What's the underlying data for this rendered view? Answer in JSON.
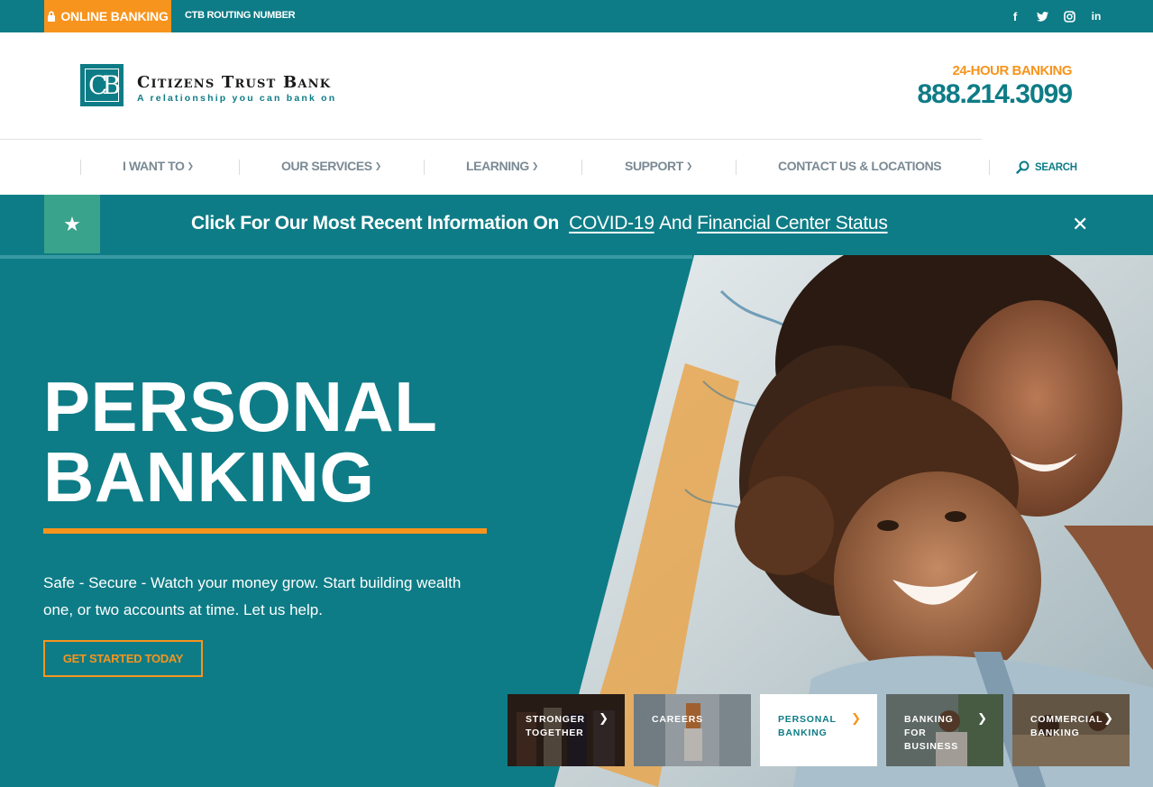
{
  "topbar": {
    "online_banking": "ONLINE BANKING",
    "routing": "CTB ROUTING NUMBER",
    "social": [
      "facebook-icon",
      "twitter-icon",
      "instagram-icon",
      "linkedin-icon"
    ]
  },
  "header": {
    "logo_name": "Citizens Trust Bank",
    "logo_tagline": "A relationship you can bank on",
    "hours_label": "24-HOUR BANKING",
    "phone": "888.214.3099"
  },
  "nav": {
    "items": [
      {
        "label": "I WANT TO"
      },
      {
        "label": "OUR SERVICES"
      },
      {
        "label": "LEARNING"
      },
      {
        "label": "SUPPORT"
      },
      {
        "label": "CONTACT US & LOCATIONS"
      }
    ],
    "search": "SEARCH"
  },
  "alert": {
    "lead": "Click For Our Most Recent Information On",
    "link1": "COVID-19",
    "and": "And",
    "link2": "Financial Center Status"
  },
  "hero": {
    "title_line1": "PERSONAL",
    "title_line2": "BANKING",
    "copy": "Safe - Secure - Watch your money grow. Start building wealth one, or two accounts at time. Let us help.",
    "cta": "GET STARTED TODAY"
  },
  "tiles": [
    {
      "label": "STRONGER TOGETHER"
    },
    {
      "label": "CAREERS"
    },
    {
      "label": "PERSONAL BANKING"
    },
    {
      "label": "BANKING FOR BUSINESS"
    },
    {
      "label": "COMMERCIAL BANKING"
    }
  ],
  "colors": {
    "teal": "#0e7c86",
    "orange": "#f7941d",
    "green": "#3aa38b"
  }
}
